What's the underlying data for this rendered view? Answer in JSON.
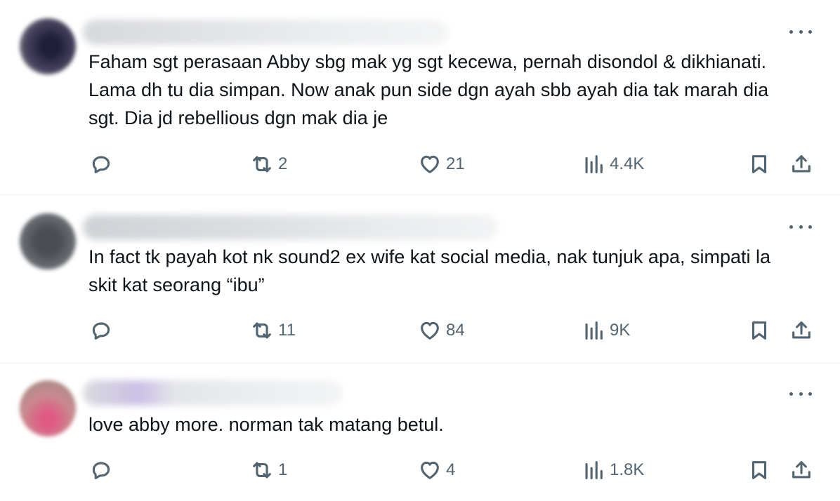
{
  "tweets": [
    {
      "text": "Faham sgt perasaan Abby sbg mak yg sgt kecewa, pernah disondol & dikhianati. Lama dh tu dia simpan. Now anak pun side dgn ayah sbb ayah dia tak marah dia sgt. Dia jd rebellious dgn mak dia je",
      "retweets": "2",
      "likes": "21",
      "views": "4.4K",
      "avatar_color": "#2a2a4a"
    },
    {
      "text": "In fact tk payah kot nk sound2 ex wife kat social media, nak tunjuk apa, simpati la skit kat seorang “ibu”",
      "retweets": "11",
      "likes": "84",
      "views": "9K",
      "avatar_color": "#555a60"
    },
    {
      "text": "love abby more. norman tak matang betul.",
      "retweets": "1",
      "likes": "4",
      "views": "1.8K",
      "avatar_color": "#c9707e"
    }
  ],
  "colors": {
    "text": "#0f1419",
    "icon": "#536471",
    "divider": "#eff3f4"
  }
}
